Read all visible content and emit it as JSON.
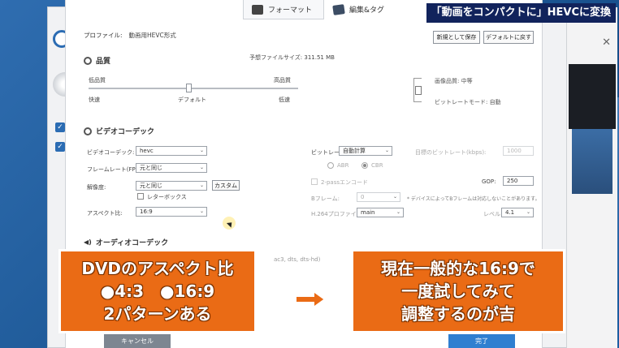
{
  "banner": "「動画をコンパクトに」HEVCに変換",
  "tabs": [
    {
      "label": "フォーマット"
    },
    {
      "label": "編集&タグ"
    }
  ],
  "profile": {
    "label": "プロファイル:",
    "value": "動画用HEVC形式"
  },
  "buttons": {
    "save_new": "新規として保存",
    "restore_default": "デフォルトに戻す",
    "cancel": "キャンセル",
    "done": "完了",
    "custom": "カスタム"
  },
  "quality": {
    "heading": "品質",
    "estimated_size": "予想ファイルサイズ: 311.51 MB",
    "low": "低品質",
    "high": "高品質",
    "fast": "快速",
    "default": "デフォルト",
    "slow": "低速",
    "slider_fraction": 0.47,
    "image_quality": "画像品質: 中等",
    "bitrate_mode": "ビットレートモード: 自動"
  },
  "video_codec": {
    "heading": "ビデオコーデック",
    "codec_label": "ビデオコーデック:",
    "codec_value": "hevc",
    "framerate_label": "フレームレート(FPS):",
    "framerate_value": "元と同じ",
    "resolution_label": "解像度:",
    "resolution_value": "元と同じ",
    "letterbox_label": "レターボックス",
    "aspect_label": "アスペクト比:",
    "aspect_value": "16:9",
    "bitrate_label": "ビットレート:",
    "bitrate_value": "自動計算",
    "target_bitrate_label": "目標のビットレート(kbps):",
    "target_bitrate_value": "1000",
    "abr": "ABR",
    "cbr": "CBR",
    "twopass_label": "2-passエンコード",
    "gop_label": "GOP:",
    "gop_value": "250",
    "bframe_label": "Bフレーム:",
    "bframe_value": "0",
    "bframe_note": "* デバイスによってBフレームは対応しないことがあります。",
    "h264_label": "H.264プロファイル:",
    "h264_value": "main",
    "level_label": "レベル:",
    "level_value": "4.1"
  },
  "audio": {
    "heading": "オーディオコーデック",
    "faded_text": "ac3, dts, dts-hd)"
  },
  "callout_left": [
    "DVDのアスペクト比",
    "●4:3　●16:9",
    "2パターンある"
  ],
  "callout_right": [
    "現在一般的な16:9で",
    "一度試してみて",
    "調整するのが吉"
  ],
  "colors": {
    "callout": "#ea6b15",
    "banner": "#11235c",
    "done": "#2f7fd0"
  }
}
